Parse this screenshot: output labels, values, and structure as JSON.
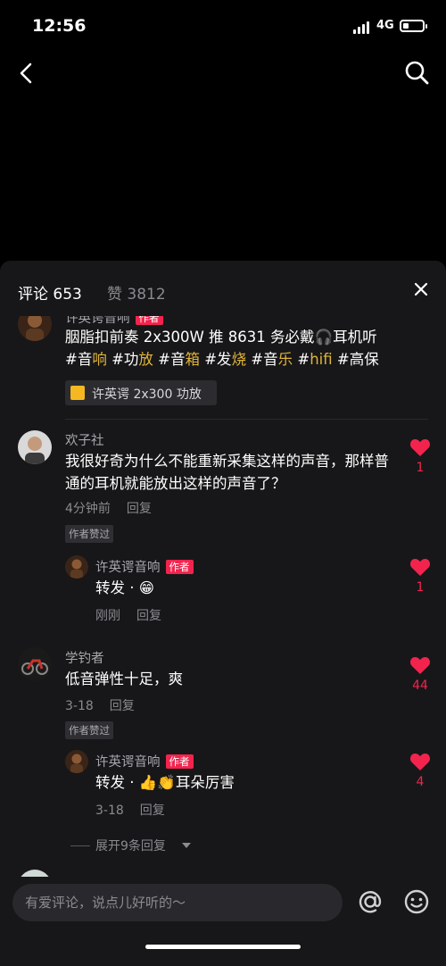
{
  "status_bar": {
    "time": "12:56",
    "network": "4G"
  },
  "sheet": {
    "tabs": [
      {
        "label": "评论 653"
      },
      {
        "label": "赞 3812"
      }
    ]
  },
  "pinned": {
    "username": "许英谔音响",
    "author_tag": "作者",
    "text_segments": [
      {
        "t": "胭脂扣前奏 2x300W 推 8631 务必戴"
      },
      {
        "t": "🎧",
        "type": "emoji"
      },
      {
        "t": "耳机听"
      },
      {
        "br": true
      },
      {
        "t": "#音"
      },
      {
        "t": "响",
        "type": "hl"
      },
      {
        "t": " #功"
      },
      {
        "t": "放",
        "type": "hl"
      },
      {
        "t": " #音"
      },
      {
        "t": "箱",
        "type": "hl"
      },
      {
        "t": " #发"
      },
      {
        "t": "烧",
        "type": "hl"
      },
      {
        "t": " #音"
      },
      {
        "t": "乐",
        "type": "hl"
      },
      {
        "t": " #"
      },
      {
        "t": "hifi",
        "type": "hl"
      },
      {
        "t": " #高保"
      }
    ],
    "product_label": "许英谔 2x300 功放"
  },
  "comments": [
    {
      "username": "欢子社",
      "text": "我很好奇为什么不能重新采集这样的声音，那样普通的耳机就能放出这样的声音了？",
      "time": "4分钟前",
      "reply_label": "回复",
      "badge": "作者赞过",
      "likes": "1",
      "reply": {
        "username": "许英谔音响",
        "author_tag": "作者",
        "text": "转发 · 😁",
        "time": "刚刚",
        "reply_label": "回复",
        "likes": "1"
      }
    },
    {
      "username": "学钓者",
      "text": "低音弹性十足，爽",
      "time": "3-18",
      "reply_label": "回复",
      "badge": "作者赞过",
      "likes": "44",
      "reply": {
        "username": "许英谔音响",
        "author_tag": "作者",
        "text": "转发 · 👍👏耳朵厉害",
        "time": "3-18",
        "reply_label": "回复",
        "likes": "4"
      },
      "expand_label": "展开9条回复"
    }
  ],
  "input": {
    "placeholder": "有爱评论，说点儿好听的～"
  },
  "colors": {
    "accent": "#f2244e",
    "hashtag": "#e0b43a",
    "sheet_bg": "#171719"
  }
}
